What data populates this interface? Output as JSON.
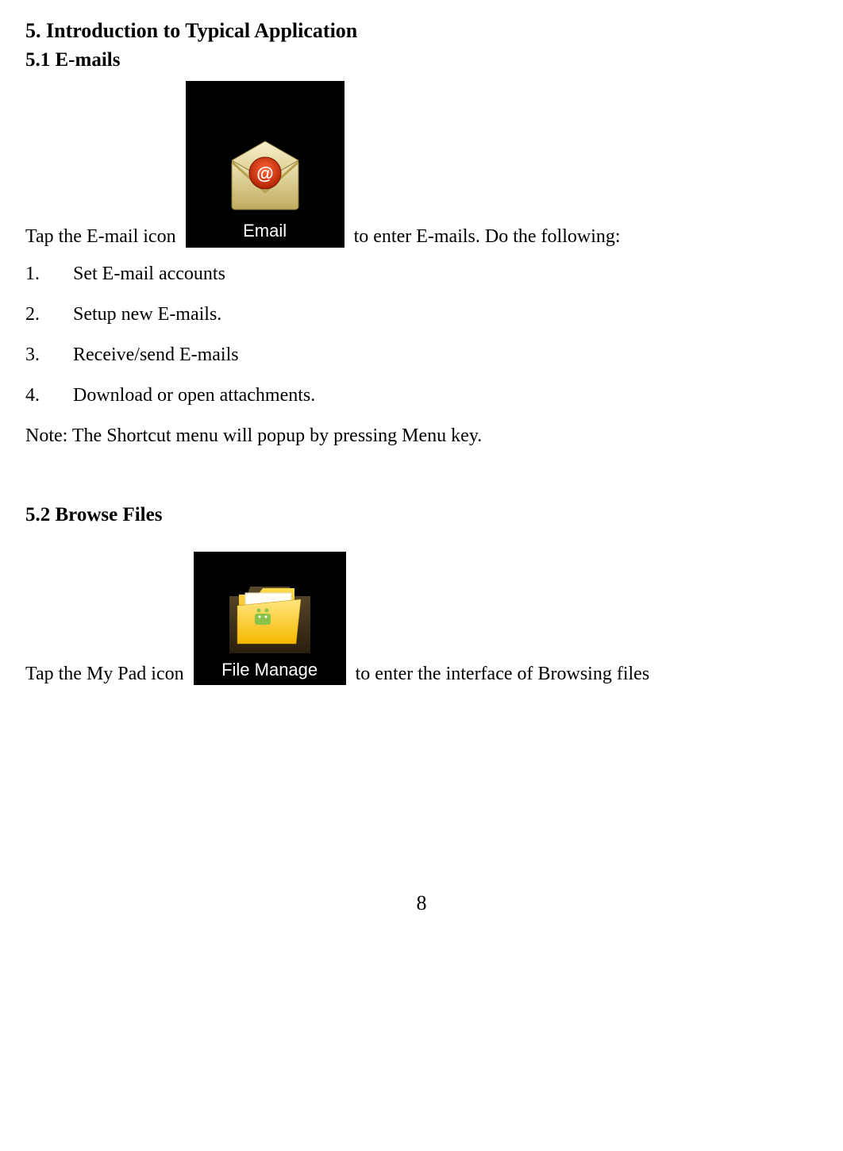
{
  "section5": {
    "heading": "5. Introduction to Typical Application"
  },
  "section51": {
    "heading": "5.1 E-mails",
    "para_before": "Tap the E-mail icon",
    "icon_label": "Email",
    "para_after": "to enter E-mails. Do the following:",
    "list": [
      "Set E-mail accounts",
      "Setup new E-mails.",
      "Receive/send E-mails",
      "Download or open attachments."
    ],
    "note": "Note: The Shortcut menu will popup by pressing Menu key."
  },
  "section52": {
    "heading": "5.2 Browse Files",
    "para_before": "Tap the My Pad   icon",
    "icon_label": "File Manage",
    "para_after": "to enter the interface of Browsing files"
  },
  "page_number": "8"
}
